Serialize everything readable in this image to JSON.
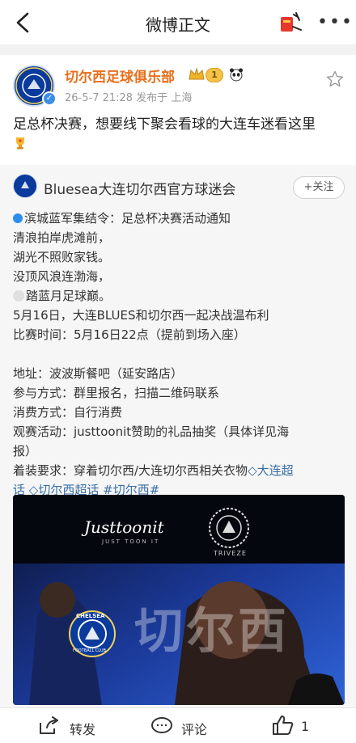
{
  "header": {
    "title": "微博正文"
  },
  "author": {
    "name": "切尔西足球俱乐部",
    "level_badge": "1",
    "meta": "26-5-7 21:28  发布于 上海"
  },
  "post": {
    "text": "足总杯决赛，想要线下聚会看球的大连车迷看这里"
  },
  "repost": {
    "name": "Bluesea大连切尔西官方球迷会",
    "follow_label": "+关注",
    "lines": [
      "滨城蓝军集结令：足总杯决赛活动通知",
      "清浪拍岸虎滩前，",
      "湖光不照败家钱。",
      "没顶风浪连渤海，",
      "踏蓝月足球巅。",
      "5月16日，大连BLUES和切尔西一起决战温布利",
      "比赛时间：5月16日22点（提前到场入座）",
      "",
      "地址：波波斯餐吧（延安路店）",
      "参与方式：群里报名，扫描二维码联系",
      "消费方式：自行消费",
      "观赛活动：justtoonit赞助的礼品抽奖（具体详见海",
      "报）"
    ],
    "dress_prefix": "着装要求：穿着切尔西/大连切尔西相关衣物",
    "topic1a": "大连超",
    "topic1b": "话",
    "topic2": "切尔西超话",
    "hashtag": "#切尔西#"
  },
  "poster": {
    "brand": "Justtoonit",
    "brand_sub": "JUST TOON IT",
    "crest_text": "TRIVEZE",
    "big_text": "切尔西",
    "club": "CHELSEA",
    "club_sub": "FOOTBALL CLUB"
  },
  "actions": {
    "repost_label": "转发",
    "comment_label": "评论",
    "like_count": "1"
  },
  "colors": {
    "author": "#e86f1a",
    "link": "#3a6ea5",
    "accent_blue": "#2d8ef0"
  }
}
